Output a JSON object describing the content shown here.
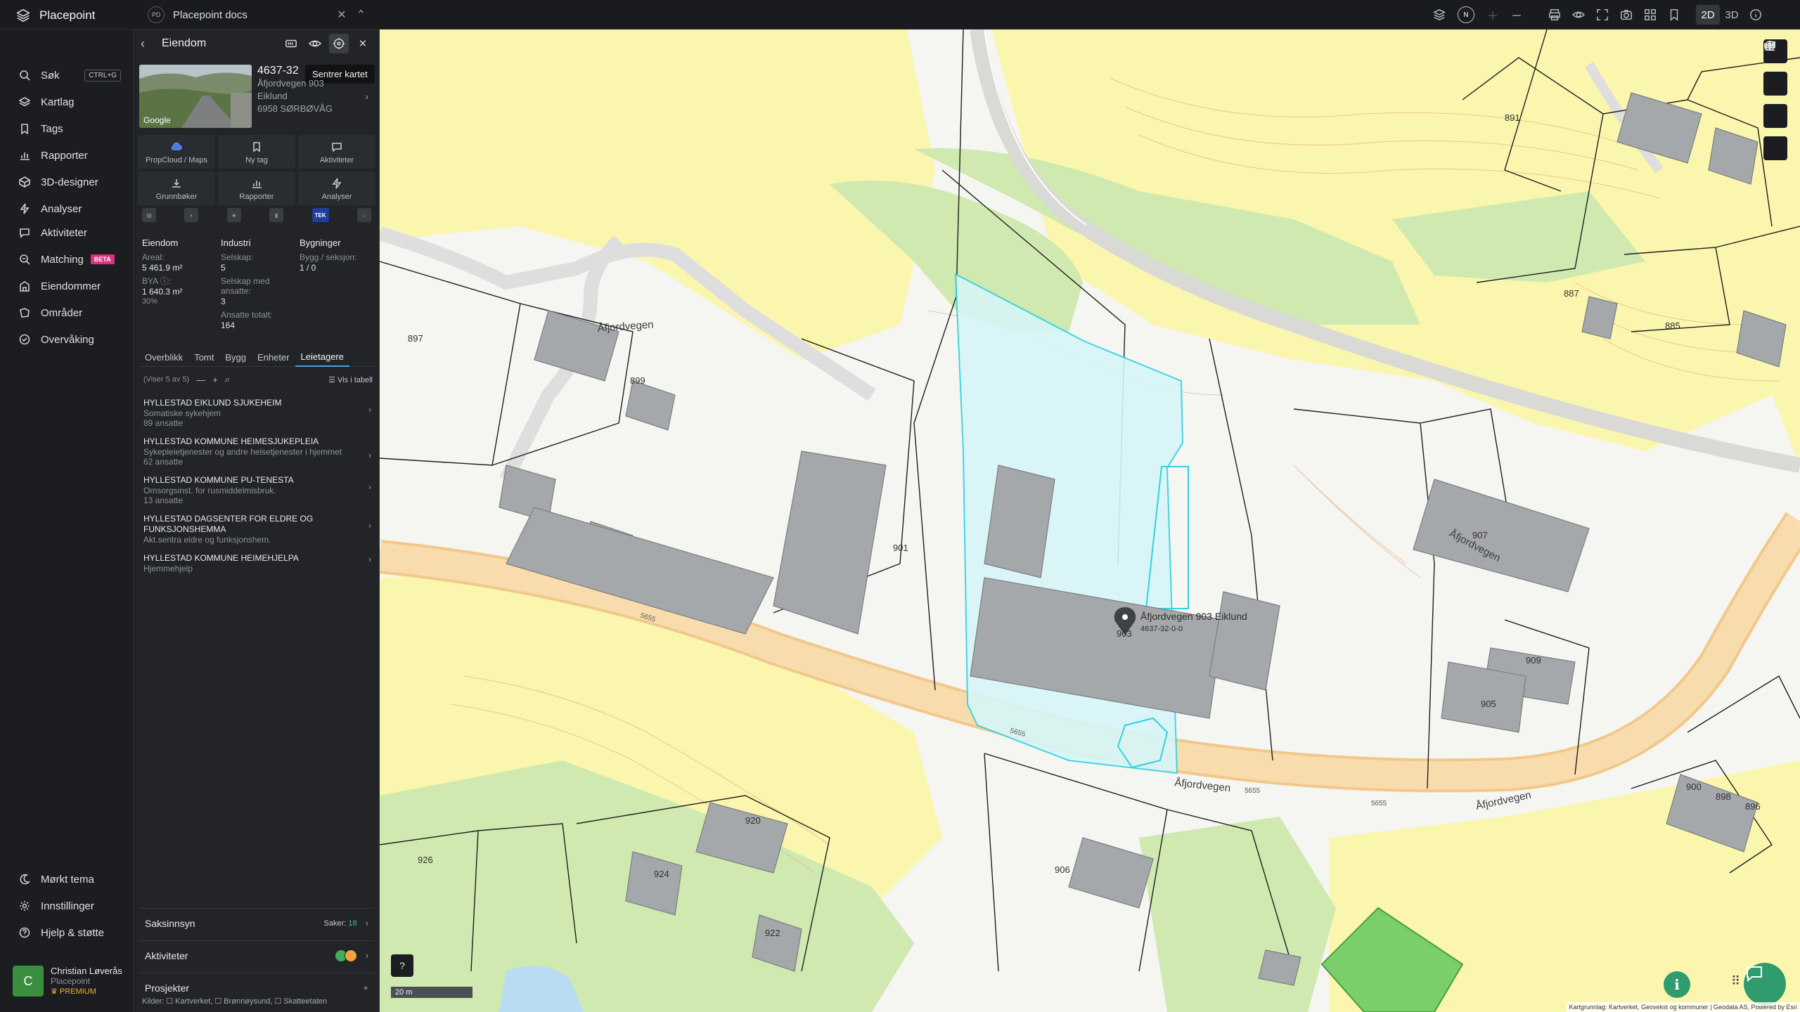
{
  "app": {
    "name": "Placepoint"
  },
  "doc_tab": {
    "badge": "PD",
    "title": "Placepoint docs"
  },
  "toolbar": {
    "north": "N",
    "view_2d": "2D",
    "view_3d": "3D"
  },
  "sidebar": {
    "items": [
      {
        "label": "Søk",
        "shortcut": "CTRL+G",
        "icon": "search-icon"
      },
      {
        "label": "Kartlag",
        "icon": "layers-icon"
      },
      {
        "label": "Tags",
        "icon": "bookmark-icon"
      },
      {
        "label": "Rapporter",
        "icon": "chart-icon"
      },
      {
        "label": "3D-designer",
        "icon": "cube-icon"
      },
      {
        "label": "Analyser",
        "icon": "bolt-icon"
      },
      {
        "label": "Aktiviteter",
        "icon": "chat-icon"
      },
      {
        "label": "Matching",
        "badge": "BETA",
        "icon": "match-icon"
      },
      {
        "label": "Eiendommer",
        "icon": "building-icon"
      },
      {
        "label": "Områder",
        "icon": "area-icon"
      },
      {
        "label": "Overvåking",
        "icon": "monitor-icon"
      }
    ],
    "bottom": [
      {
        "label": "Mørkt tema",
        "icon": "moon-icon"
      },
      {
        "label": "Innstillinger",
        "icon": "gear-icon"
      },
      {
        "label": "Hjelp & støtte",
        "icon": "help-icon"
      }
    ],
    "user": {
      "initial": "C",
      "name": "Christian Løverås",
      "org": "Placepoint",
      "plan": "PREMIUM"
    }
  },
  "panel": {
    "title": "Eiendom",
    "tooltip": "Sentrer kartet",
    "property": {
      "gnr": "4637-32",
      "address": "Åfjordvegen 903",
      "place": "Eiklund",
      "postal": "6958 SØRBØVÅG",
      "image_label": "Google"
    },
    "actions": [
      {
        "label": "PropCloud / Maps",
        "icon": "cloud-icon"
      },
      {
        "label": "Ny tag",
        "icon": "bookmark-icon"
      },
      {
        "label": "Aktiviteter",
        "icon": "chat-icon"
      },
      {
        "label": "Grunnbøker",
        "icon": "download-icon"
      },
      {
        "label": "Rapporter",
        "icon": "chart-icon"
      },
      {
        "label": "Analyser",
        "icon": "bolt-icon"
      }
    ],
    "data_sources": {
      "tek": "TEK"
    },
    "facts": {
      "eiendom": {
        "head": "Eiendom",
        "areal_label": "Areal:",
        "areal_value": "5 461.9 m²",
        "bya_label": "BYA ⓘ:",
        "bya_value": "1 640.3 m²",
        "bya_pct": "30%"
      },
      "industri": {
        "head": "Industri",
        "selskap_label": "Selskap:",
        "selskap_value": "5",
        "ansatte_label": "Selskap med ansatte:",
        "ansatte_value": "3",
        "totalt_label": "Ansatte totalt:",
        "totalt_value": "164"
      },
      "bygninger": {
        "head": "Bygninger",
        "bygg_label": "Bygg / seksjon:",
        "bygg_value": "1 / 0"
      }
    },
    "tabs": [
      "Overblikk",
      "Tomt",
      "Bygg",
      "Enheter",
      "Leietagere"
    ],
    "list": {
      "count": "(Viser 5 av 5)",
      "view_table": "Vis i tabell"
    },
    "tenants": [
      {
        "name": "HYLLESTAD EIKLUND SJUKEHEIM",
        "desc": "Somatiske sykehjem",
        "employees": "89 ansatte"
      },
      {
        "name": "HYLLESTAD KOMMUNE HEIMESJUKEPLEIA",
        "desc": "Sykepleietjenester og andre helsetjenester i hjemmet",
        "employees": "62 ansatte"
      },
      {
        "name": "HYLLESTAD KOMMUNE PU-TENESTA",
        "desc": "Omsorgsinst. for rusmiddelmisbruk.",
        "employees": "13 ansatte"
      },
      {
        "name": "HYLLESTAD DAGSENTER FOR ELDRE OG FUNKSJONSHEMMA",
        "desc": "Akt.sentra eldre og funksjonshem.",
        "employees": ""
      },
      {
        "name": "HYLLESTAD KOMMUNE HEIMEHJELPA",
        "desc": "Hjemmehjelp",
        "employees": ""
      }
    ],
    "sections": {
      "saksinnsyn": {
        "title": "Saksinnsyn",
        "meta_label": "Saker:",
        "meta_value": "18"
      },
      "aktiviteter": {
        "title": "Aktiviteter"
      },
      "prosjekter": {
        "title": "Prosjekter",
        "action": "+"
      }
    },
    "sources": "Kilder: ☐ Kartverket, ☐ Brønnøysund, ☐ Skatteetaten"
  },
  "map": {
    "streets": [
      "Åfjordvegen",
      "Åfjordvegen",
      "Åfjordvegen",
      "Åfjordvegen"
    ],
    "road_numbers": [
      "5655",
      "5655",
      "5655",
      "5655"
    ],
    "house_numbers": [
      "891",
      "887",
      "885",
      "897",
      "899",
      "901",
      "903",
      "907",
      "909",
      "905",
      "906",
      "920",
      "926",
      "924",
      "922",
      "900",
      "898",
      "896"
    ],
    "marker_label": "Åfjordvegen 903 Eiklund",
    "marker_sub": "4637-32-0-0",
    "scale": "20 m",
    "attribution": "Kartgrunnlag: Kartverket, Geovekst og kommuner | Geodata AS, Powered by Esri",
    "colors": {
      "yellow": "#fbf5a8",
      "green": "#cfe9b0",
      "road": "#f6d6a2",
      "building": "#a6a9ab",
      "selection": "#2fd2e0"
    }
  }
}
